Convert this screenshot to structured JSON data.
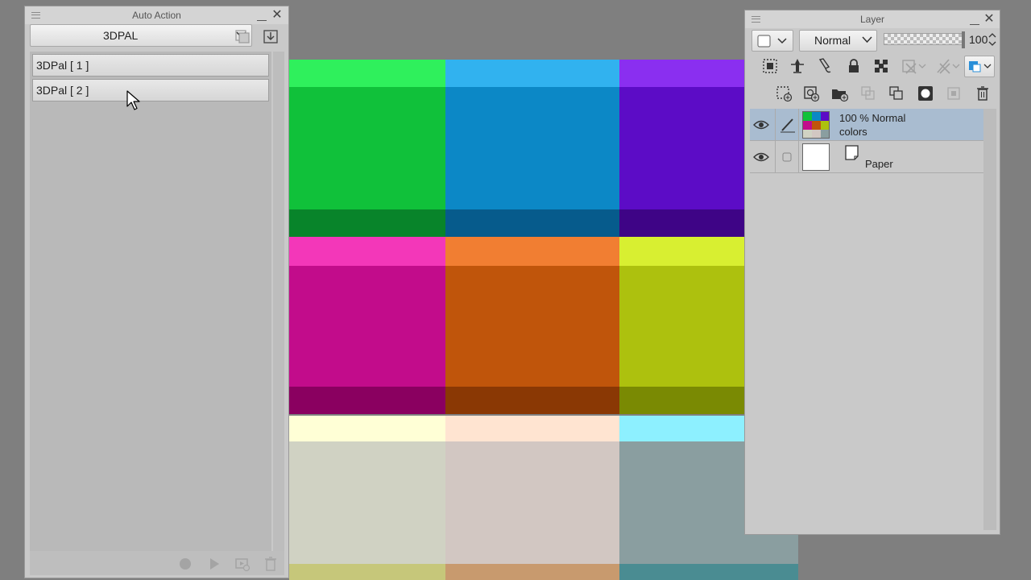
{
  "canvas": {
    "columns": [
      {
        "top": "#2ff05c",
        "mid": "#10c13a",
        "bot": "#08842a"
      },
      {
        "top": "#31b2ef",
        "mid": "#0c88c6",
        "bot": "#065b8c"
      },
      {
        "top": "#8a2ff0",
        "mid": "#5c0cc6",
        "bot": "#3e0486"
      }
    ],
    "columns_row2": [
      {
        "top": "#f337b9",
        "mid": "#c20c8b",
        "bot": "#8a0060"
      },
      {
        "top": "#f17e32",
        "mid": "#c0550b",
        "bot": "#8a3804"
      },
      {
        "top": "#d8ef31",
        "mid": "#adc10e",
        "bot": "#7a8a03"
      }
    ],
    "columns_row3": [
      {
        "top": "#ffffd6",
        "mid": "#d0d2c3",
        "bot": "#c6c77a"
      },
      {
        "top": "#ffe4d1",
        "mid": "#d2c7c2",
        "bot": "#c89a6e"
      },
      {
        "top": "#8df0ff",
        "mid": "#8a9ea0",
        "bot": "#4a8c92"
      }
    ]
  },
  "auto_action": {
    "title": "Auto Action",
    "set_name": "3DPAL",
    "items": [
      "3DPal [ 1 ]",
      "3DPal [ 2 ]"
    ]
  },
  "layer": {
    "title": "Layer",
    "blend_mode": "Normal",
    "opacity": "100",
    "opacity_fraction": 1.0,
    "layers": [
      {
        "line1": "100 % Normal",
        "line2": "colors",
        "selected": true
      },
      {
        "line1": "",
        "line2": "Paper",
        "selected": false
      }
    ]
  }
}
